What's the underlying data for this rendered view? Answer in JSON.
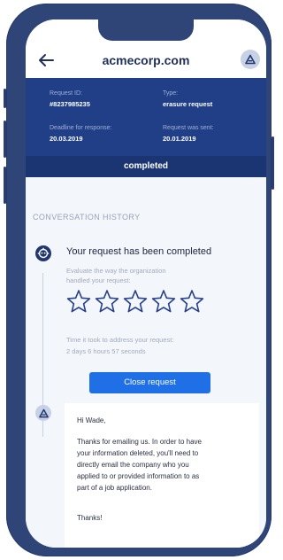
{
  "header": {
    "site": "acmecorp.com",
    "back_icon": "arrow-left-icon",
    "profile_icon": "shield-triangle-icon"
  },
  "request": {
    "id_label": "Request ID:",
    "id_value": "#8237985235",
    "type_label": "Type:",
    "type_value": "erasure request",
    "deadline_label": "Deadline for response:",
    "deadline_value": "20.03.2019",
    "sent_label": "Request was sent:",
    "sent_value": "20.01.2019",
    "status": "completed"
  },
  "history": {
    "title": "CONVERSATION HISTORY",
    "completed_event": {
      "icon": "robot-icon",
      "title": "Your request has been completed",
      "evaluate_line1": "Evaluate the way the organization",
      "evaluate_line2": "handled your request:",
      "rating": 0,
      "rating_max": 5,
      "time_label": "Time it took to address your request:",
      "time_value": "2  days 6 hours 57 seconds",
      "close_button": "Close request"
    },
    "message": {
      "icon": "shield-triangle-icon",
      "greeting": "Hi Wade,",
      "lines": [
        "Thanks for emailing us. In order to have",
        "your information deleted, you'll need to",
        "directly email the company who you",
        "applied to or provided information to as",
        "part of a job application."
      ],
      "closing": "Thanks!"
    }
  },
  "colors": {
    "frame": "#2f4477",
    "panel": "#213f86",
    "status_bar": "#1b3472",
    "button": "#1f6fe6",
    "background": "#f3f6fb"
  }
}
